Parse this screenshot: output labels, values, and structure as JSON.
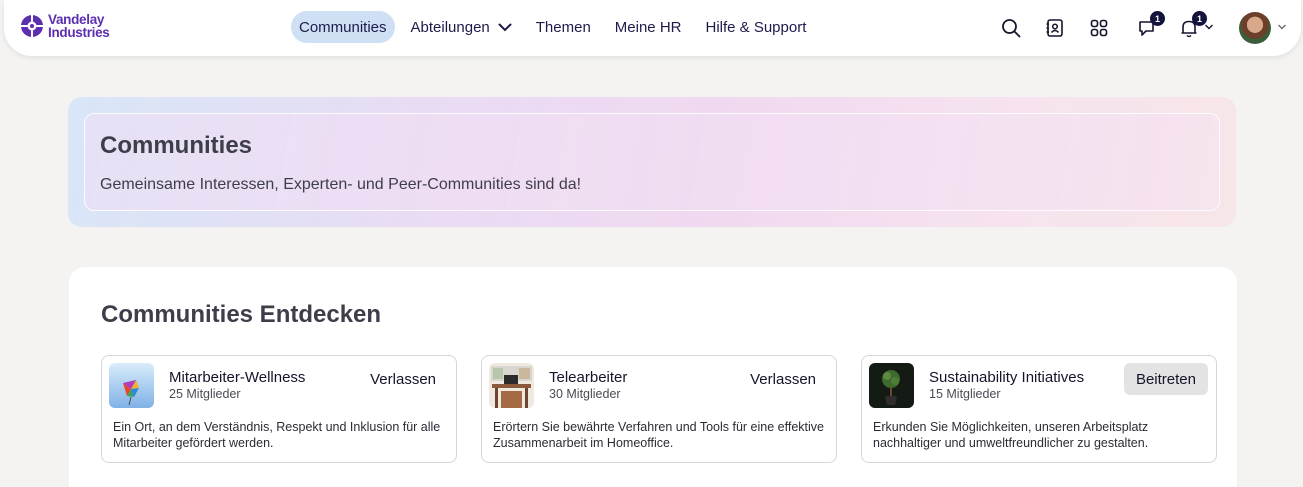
{
  "brand": {
    "line1": "Vandelay",
    "line2": "Industries",
    "color": "#5b2fae"
  },
  "nav": {
    "items": [
      {
        "label": "Communities"
      },
      {
        "label": "Abteilungen"
      },
      {
        "label": "Themen"
      },
      {
        "label": "Meine HR"
      },
      {
        "label": "Hilfe & Support"
      }
    ],
    "active": "Communities"
  },
  "toolbar": {
    "icons": [
      "search-icon",
      "contacts-icon",
      "apps-grid-icon",
      "chat-icon",
      "bell-icon",
      "chevron-down-icon"
    ],
    "chat_badge": "1",
    "bell_badge": "1"
  },
  "hero": {
    "title": "Communities",
    "subtitle": "Gemeinsame Interessen, Experten- und Peer-Communities sind da!"
  },
  "discover": {
    "title": "Communities Entdecken",
    "cards": [
      {
        "name": "Mitarbeiter-Wellness",
        "members": "25 Mitglieder",
        "action": "Verlassen",
        "description": "Ein Ort, an dem Verständnis, Respekt und Inklusion für alle Mitarbeiter gefördert werden."
      },
      {
        "name": "Telearbeiter",
        "members": "30 Mitglieder",
        "action": "Verlassen",
        "description": "Erörtern Sie bewährte Verfahren und Tools für eine effektive Zusammenarbeit im Homeoffice."
      },
      {
        "name": "Sustainability Initiatives",
        "members": "15 Mitglieder",
        "action": "Beitreten",
        "description": "Erkunden Sie Möglichkeiten, unseren Arbeitsplatz nachhaltiger und umweltfreundlicher zu gestalten."
      }
    ]
  },
  "colors": {
    "accent": "#cfe0f5",
    "navText": "#1e1b4b",
    "background": "#f4f3f2"
  }
}
